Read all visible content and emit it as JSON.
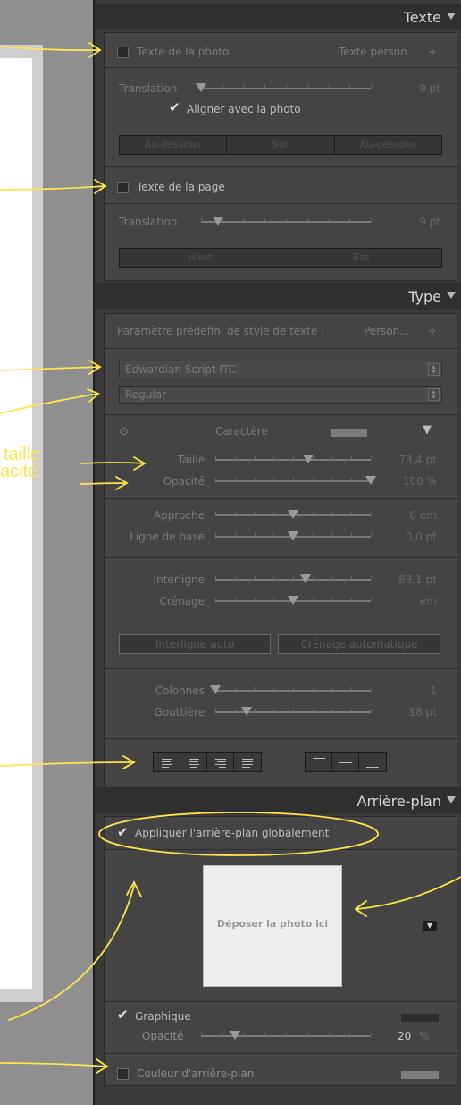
{
  "panel": {
    "texte": {
      "header": "Texte",
      "photo_text": {
        "label": "Texte de la photo",
        "preset": "Texte person.",
        "preset_arrow": "÷"
      },
      "translation_label": "Translation",
      "translation_value": "9 pt",
      "align_checkbox": {
        "label": "Aligner avec la photo",
        "checked": true
      },
      "positions": [
        "Au-dessous",
        "Sur",
        "Au-dessous"
      ],
      "page_text": {
        "label": "Texte de la page"
      },
      "page_translation_label": "Translation",
      "page_translation_value": "9 pt",
      "page_positions": [
        "Haut",
        "Bas"
      ]
    },
    "type": {
      "header": "Type",
      "preset_label": "Paramètre prédéfini de style de texte :",
      "preset_value": "Person...",
      "preset_arrow": "÷",
      "font_family": "Edwardian Script ITC",
      "font_style": "Regular",
      "character_label": "Caractère",
      "size_label": "Taille",
      "size_value": "73,4 pt",
      "size_level": 0.6,
      "opacity_label": "Opacité",
      "opacity_value": "100 %",
      "opacity_level": 1.0,
      "tracking_label": "Approche",
      "tracking_value": "0 em",
      "tracking_level": 0.5,
      "baseline_label": "Ligne de base",
      "baseline_value": "0,0 pt",
      "baseline_level": 0.5,
      "leading_label": "Interligne",
      "leading_value": "88,1 pt",
      "leading_level": 0.58,
      "kerning_label": "Crénage",
      "kerning_value": "em",
      "kerning_level": 0.5,
      "auto_leading": "Interligne auto",
      "auto_kerning": "Crénage automatique",
      "columns_label": "Colonnes",
      "columns_value": "1",
      "columns_level": 0.0,
      "gutter_label": "Gouttière",
      "gutter_value": "18 pt",
      "gutter_level": 0.2
    },
    "background": {
      "header": "Arrière-plan",
      "apply_globally": {
        "label": "Appliquer l'arrière-plan globalement",
        "checked": true
      },
      "drop_photo": "Déposer la photo ici",
      "graphic": {
        "label": "Graphique",
        "checked": true
      },
      "graphic_opacity_label": "Opacité",
      "graphic_opacity_value": "20",
      "graphic_opacity_unit": "%",
      "graphic_opacity_level": 0.2,
      "bg_color": {
        "label": "Couleur d'arrière-plan",
        "checked": false
      }
    }
  },
  "annotations": {
    "taille": "taille",
    "opacite": "acité"
  },
  "colors": {
    "panel_bg": "#3a3a3a",
    "annotation": "#ffe44a"
  }
}
